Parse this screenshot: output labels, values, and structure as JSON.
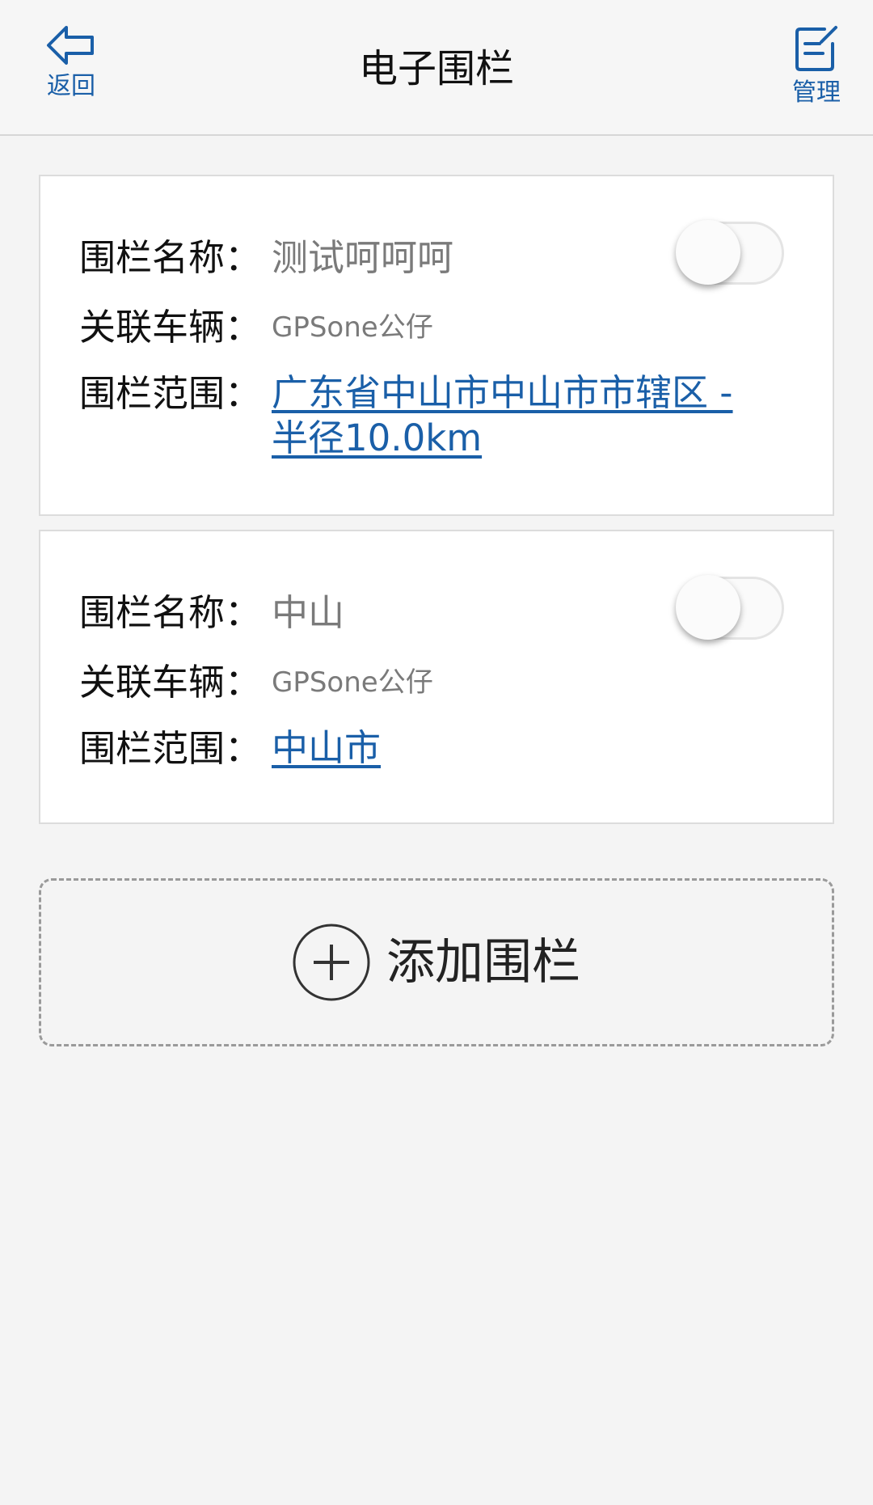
{
  "header": {
    "title": "电子围栏",
    "back_label": "返回",
    "manage_label": "管理",
    "accent_color": "#1a5fa8"
  },
  "fences": [
    {
      "name_key": "围栏名称：",
      "name": "测试呵呵呵",
      "vehicle_key": "关联车辆：",
      "vehicle": "GPSone公仔",
      "range_key": "围栏范围：",
      "range": "广东省中山市中山市市辖区 - 半径10.0km",
      "enabled": false
    },
    {
      "name_key": "围栏名称：",
      "name": "中山",
      "vehicle_key": "关联车辆：",
      "vehicle": "GPSone公仔",
      "range_key": "围栏范围：",
      "range": "中山市",
      "enabled": false
    }
  ],
  "add_fence_label": "添加围栏"
}
